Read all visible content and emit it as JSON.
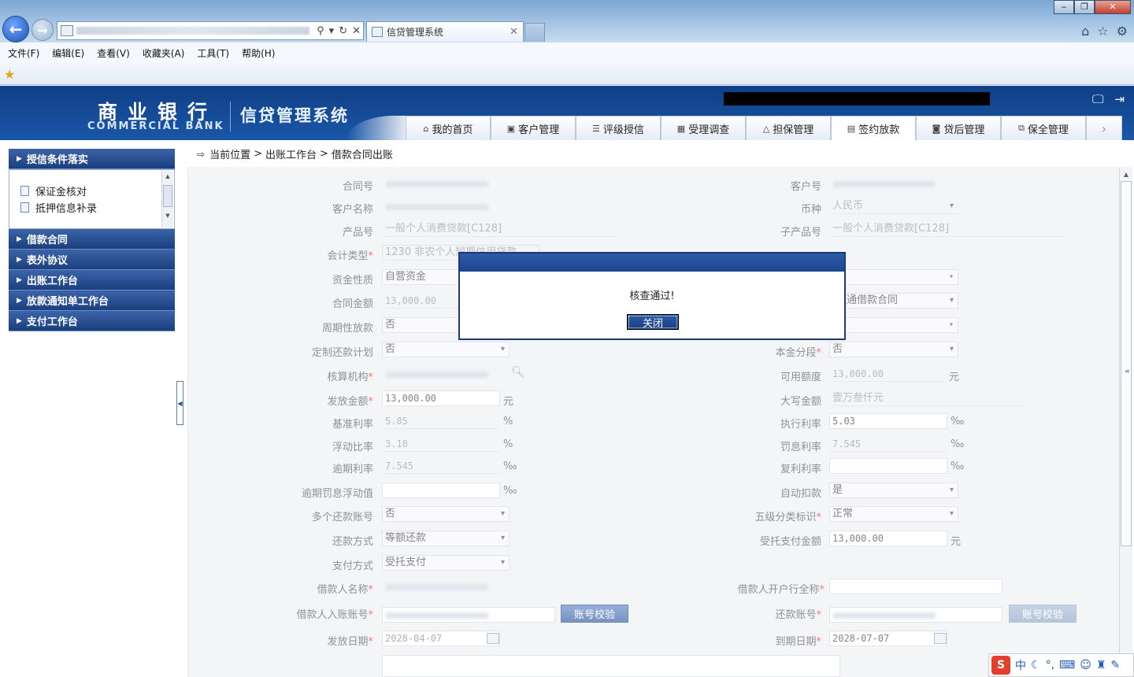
{
  "browser": {
    "tab_title": "信贷管理系统",
    "tab_close": "✕",
    "menu": [
      "文件(F)",
      "编辑(E)",
      "查看(V)",
      "收藏夹(A)",
      "工具(T)",
      "帮助(H)"
    ],
    "icons": {
      "back": "arrow-left-icon",
      "forward": "arrow-right-icon",
      "home": "home-icon",
      "favorites": "star-icon",
      "settings": "gear-icon"
    }
  },
  "header": {
    "logo_cn": "商业银行",
    "logo_en": "COMMERCIAL BANK",
    "system_title": "信贷管理系统",
    "tabs": [
      {
        "label": "我的首页",
        "icon": "home-icon"
      },
      {
        "label": "客户管理",
        "icon": "customer-icon"
      },
      {
        "label": "评级授信",
        "icon": "rating-icon"
      },
      {
        "label": "受理调查",
        "icon": "survey-icon"
      },
      {
        "label": "担保管理",
        "icon": "guarantee-icon"
      },
      {
        "label": "签约放款",
        "icon": "contract-icon"
      },
      {
        "label": "贷后管理",
        "icon": "post-loan-icon"
      },
      {
        "label": "保全管理",
        "icon": "preservation-icon"
      }
    ],
    "active_tab": 5
  },
  "sidebar": {
    "sections": [
      {
        "label": "授信条件落实",
        "expanded": true,
        "items": [
          "保证金核对",
          "抵押信息补录"
        ]
      },
      {
        "label": "借款合同"
      },
      {
        "label": "表外协议"
      },
      {
        "label": "出账工作台"
      },
      {
        "label": "放款通知单工作台"
      },
      {
        "label": "支付工作台"
      }
    ]
  },
  "breadcrumb": {
    "prefix": "当前位置",
    "sep": ">",
    "level1": "出账工作台",
    "level2": "借款合同出账"
  },
  "form": {
    "labels": {
      "contract_no": "合同号",
      "customer_no": "客户号",
      "customer_name": "客户名称",
      "currency": "币种",
      "product_no": "产品号",
      "sub_product_no": "子产品号",
      "accounting_type": "会计类型",
      "fund_nature": "资金性质",
      "contract_amount": "合同金额",
      "periodic_loan": "周期性放款",
      "custom_repay_plan": "定制还款计划",
      "principal_segment": "本金分段",
      "accounting_org": "核算机构",
      "available_amount": "可用额度",
      "loan_amount": "发放金额",
      "amount_upper": "大写金额",
      "base_rate": "基准利率",
      "exec_rate": "执行利率",
      "float_ratio": "浮动比率",
      "penalty_rate": "罚息利率",
      "overdue_rate": "逾期利率",
      "compound_rate": "复利利率",
      "overdue_penalty_float": "逾期罚息浮动值",
      "auto_deduct": "自动扣款",
      "multi_repay_acct": "多个还款账号",
      "five_class": "五级分类标识",
      "repay_method": "还款方式",
      "entrusted_pay_amount": "受托支付金额",
      "pay_method": "支付方式",
      "borrower_name": "借款人名称",
      "borrower_bank_fullname": "借款人开户行全称",
      "borrower_in_acct": "借款人入账账号",
      "repay_acct": "还款账号",
      "issue_date": "发放日期",
      "due_date": "到期日期"
    },
    "values": {
      "currency": "人民币",
      "product_no": "一般个人消费贷款[C128]",
      "sub_product_no": "一般个人消费贷款[C128]",
      "accounting_type": "1230 非农个人短期信用贷款",
      "fund_nature": "自营资金",
      "contract_amount": "13,000.00",
      "contract_type": "通借款合同",
      "periodic_loan": "否",
      "custom_repay_plan": "否",
      "principal_segment": "否",
      "available_amount": "13,000.00",
      "loan_amount": "13,000.00",
      "amount_upper": "壹万叁仟元",
      "base_rate": "5.85",
      "exec_rate": "5.03",
      "float_ratio": "3.18",
      "penalty_rate": "7.545",
      "overdue_rate": "7.545",
      "compound_rate": "",
      "overdue_penalty_float": "",
      "auto_deduct": "是",
      "multi_repay_acct": "否",
      "five_class": "正常",
      "repay_method": "等额还款",
      "entrusted_pay_amount": "13,000.00",
      "pay_method": "受托支付",
      "issue_date": "2028-04-07",
      "due_date": "2028-07-07"
    },
    "units": {
      "yuan": "元",
      "percent": "%",
      "permille": "‰"
    },
    "required_mark": "*",
    "buttons": {
      "verify_account": "账号校验",
      "verify_repay_account": "账号校验"
    }
  },
  "dialog": {
    "message": "核查通过!",
    "close_label": "关闭"
  },
  "ime": {
    "lang": "中"
  },
  "colors": {
    "header_blue": "#1a57a8",
    "dialog_title": "#1d4590",
    "required": "#e33333"
  }
}
